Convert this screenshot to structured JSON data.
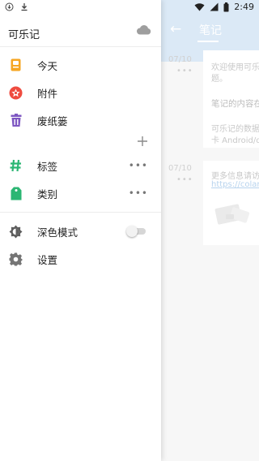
{
  "status_bar": {
    "time": "2:49",
    "left_icons": [
      "download-circle-icon",
      "download-icon"
    ],
    "right_icons": [
      "wifi-icon",
      "signal-icon",
      "battery-icon"
    ]
  },
  "drawer": {
    "app_title": "可乐记",
    "sync_icon": "cloud-icon",
    "primary_items": [
      {
        "label": "今天",
        "icon": "today-icon",
        "color": "#f6a623"
      },
      {
        "label": "附件",
        "icon": "attachment-icon",
        "color": "#ef4b3f"
      },
      {
        "label": "废纸篓",
        "icon": "trash-icon",
        "color": "#7e57c2"
      }
    ],
    "tag_item": {
      "label": "标签",
      "icon": "hashtag-icon",
      "color": "#2bb673"
    },
    "category_item": {
      "label": "类别",
      "icon": "category-icon",
      "color": "#2bb673"
    },
    "dark_mode": {
      "label": "深色模式",
      "enabled": false
    },
    "settings": {
      "label": "设置"
    }
  },
  "background": {
    "header_title": "笔记",
    "header_color": "#dbe9f6",
    "notes": [
      {
        "date": "07/10",
        "lines": [
          "欢迎使用可乐",
          "题。",
          "笔记的内容在",
          "可乐记的数据",
          "卡 Android/da"
        ]
      },
      {
        "date": "07/10",
        "lines": [
          "更多信息请访"
        ],
        "link": "https://colano"
      }
    ]
  }
}
